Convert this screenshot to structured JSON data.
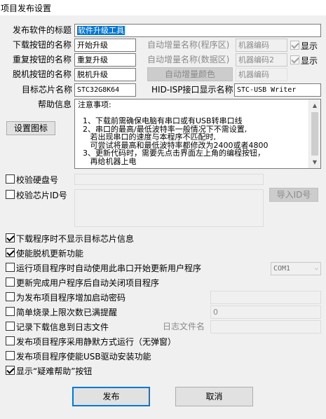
{
  "window": {
    "title": "项目发布设置"
  },
  "form": {
    "title_label": "发布软件的标题",
    "title_value": "软件升级工具",
    "download_btn_label": "下载按钮的名称",
    "download_btn_value": "开始升级",
    "repeat_btn_label": "重复按钮的名称",
    "repeat_btn_value": "重复升级",
    "offline_btn_label": "脱机按钮的名称",
    "offline_btn_value": "脱机升级",
    "auto_incr_prog_label": "自动增量名称(程序区)",
    "auto_incr_prog_value": "机器编码",
    "auto_incr_data_label": "自动增量名称(数据区)",
    "auto_incr_data_value": "机器编码2",
    "show_label_1": "显示",
    "show_label_2": "显示",
    "auto_incr_color_button": "自动增量颜色",
    "color_preview_value": "机器编码",
    "target_chip_label": "目标芯片名称",
    "target_chip_value": "STC32G8K64",
    "hid_label": "HID-ISP接口显示名称",
    "hid_value": "STC-USB Writer",
    "help_label": "帮助信息",
    "set_icon_button": "设置图标",
    "help_lines": [
      "注意事项:",
      "",
      "  1、下载前需确保电脑有串口或有USB转串口线",
      "  2、串口的最高/最低波特率一般情况下不需设置,",
      "     若出现串口的速度与本程序不匹配时,",
      "     可尝试将最高和最低波特率都修改为2400或者4800",
      "  3、更新代码时，需要先点击界面左上角的编程按钮，",
      "     再给机器上电"
    ]
  },
  "verify": {
    "disk_label": "校验硬盘号",
    "chipid_label": "校验芯片ID号",
    "import_id_button": "导入ID号"
  },
  "options": [
    {
      "label": "下载程序时不显示目标芯片信息",
      "checked": true
    },
    {
      "label": "使能脱机更新功能",
      "checked": true
    },
    {
      "label": "运行项目程序时自动使用此串口开始更新用户程序",
      "checked": false
    },
    {
      "label": "更新完成用户程序后自动关闭项目程序",
      "checked": false
    },
    {
      "label": "为发布项目程序增加启动密码",
      "checked": false
    },
    {
      "label": "简单烧录上限次数已满提醒",
      "checked": false
    },
    {
      "label": "记录下载信息到日志文件",
      "checked": false
    },
    {
      "label": "发布项目程序采用静默方式运行（无弹窗）",
      "checked": false
    },
    {
      "label": "发布项目程序使能USB驱动安装功能",
      "checked": false
    },
    {
      "label": "显示“疑难帮助”按钮",
      "checked": true
    }
  ],
  "com_port": {
    "value": "COM1",
    "arrow": "⌵"
  },
  "limit_count_value": "0",
  "log_file_label": "日志文件名",
  "buttons": {
    "publish": "发布",
    "cancel": "取消"
  },
  "icons": {
    "close": "close-icon",
    "checkmark": "checkmark-icon",
    "dropdown": "chevron-down-icon",
    "scroll_up": "scroll-up-arrow-icon",
    "scroll_down": "scroll-down-arrow-icon"
  },
  "colors": {
    "accent": "#0078d7",
    "window_bg": "#f0f0f0",
    "disabled_text": "#8a8a8a"
  }
}
